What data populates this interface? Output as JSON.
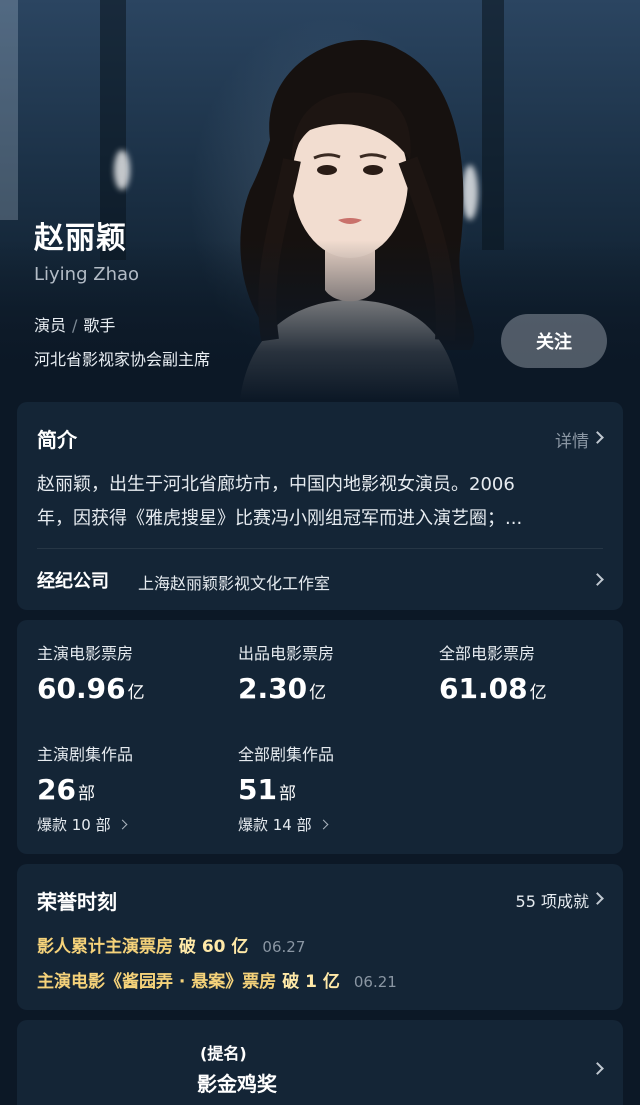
{
  "profile": {
    "name_cn": "赵丽颖",
    "name_en": "Liying Zhao",
    "roles": [
      "演员",
      "歌手"
    ],
    "role_separator": "/",
    "position": "河北省影视家协会副主席",
    "follow_label": "关注"
  },
  "intro": {
    "title": "简介",
    "more_label": "详情",
    "text_line1": "赵丽颖，出生于河北省廊坊市，中国内地影视女演员。2006",
    "text_line2": "年，因获得《雅虎搜星》比赛冯小刚组冠军而进入演艺圈；...",
    "agency_label": "经纪公司",
    "agency_value": "上海赵丽颖影视文化工作室"
  },
  "stats": {
    "items": [
      {
        "label": "主演电影票房",
        "value": "60.96",
        "unit": "亿"
      },
      {
        "label": "出品电影票房",
        "value": "2.30",
        "unit": "亿"
      },
      {
        "label": "全部电影票房",
        "value": "61.08",
        "unit": "亿"
      },
      {
        "label": "主演剧集作品",
        "value": "26",
        "unit": "部",
        "sub": "爆款 10 部"
      },
      {
        "label": "全部剧集作品",
        "value": "51",
        "unit": "部",
        "sub": "爆款 14 部"
      }
    ]
  },
  "honors": {
    "title": "荣誉时刻",
    "count_label": "55 项成就",
    "items": [
      {
        "text": "影人累计主演票房",
        "strong": "破 60 亿",
        "date": "06.27"
      },
      {
        "text": "主演电影《酱园弄 · 悬案》票房",
        "strong": "破 1 亿",
        "date": "06.21"
      }
    ]
  },
  "award": {
    "tag": "(提名)",
    "name": "影金鸡奖"
  },
  "colors": {
    "background": "#0c1826",
    "card": "#142536",
    "honor_gold": "#f5d27a",
    "follow_button": "#cdd4dc"
  }
}
